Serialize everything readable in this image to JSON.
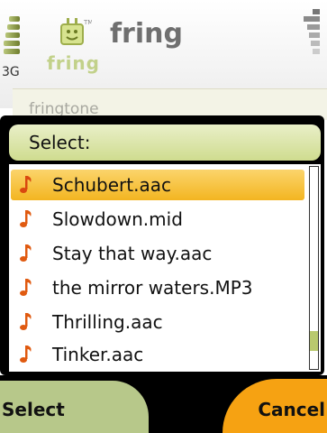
{
  "header": {
    "app_title": "fring",
    "logo_text": "fring",
    "network": "3G",
    "logo_tm": "TM"
  },
  "background_field": {
    "label": "fringtone"
  },
  "dialog": {
    "title": "Select:",
    "items": [
      {
        "label": "Schubert.aac",
        "selected": true
      },
      {
        "label": "Slowdown.mid",
        "selected": false
      },
      {
        "label": "Stay that way.aac",
        "selected": false
      },
      {
        "label": "the mirror waters.MP3",
        "selected": false
      },
      {
        "label": "Thrilling.aac",
        "selected": false
      },
      {
        "label": "Tinker.aac",
        "selected": false
      }
    ],
    "scroll_position": 0.9
  },
  "softkeys": {
    "left": "Select",
    "right": "Cancel"
  },
  "colors": {
    "accent_green": "#cfdc8f",
    "highlight": "#f3b521",
    "note_icon": "#e05a10",
    "softkey_right": "#f6a212"
  },
  "icons": {
    "list_item": "music-note-icon",
    "signal": "signal-strength-icon",
    "battery": "battery-icon",
    "logo": "fring-logo-icon"
  }
}
